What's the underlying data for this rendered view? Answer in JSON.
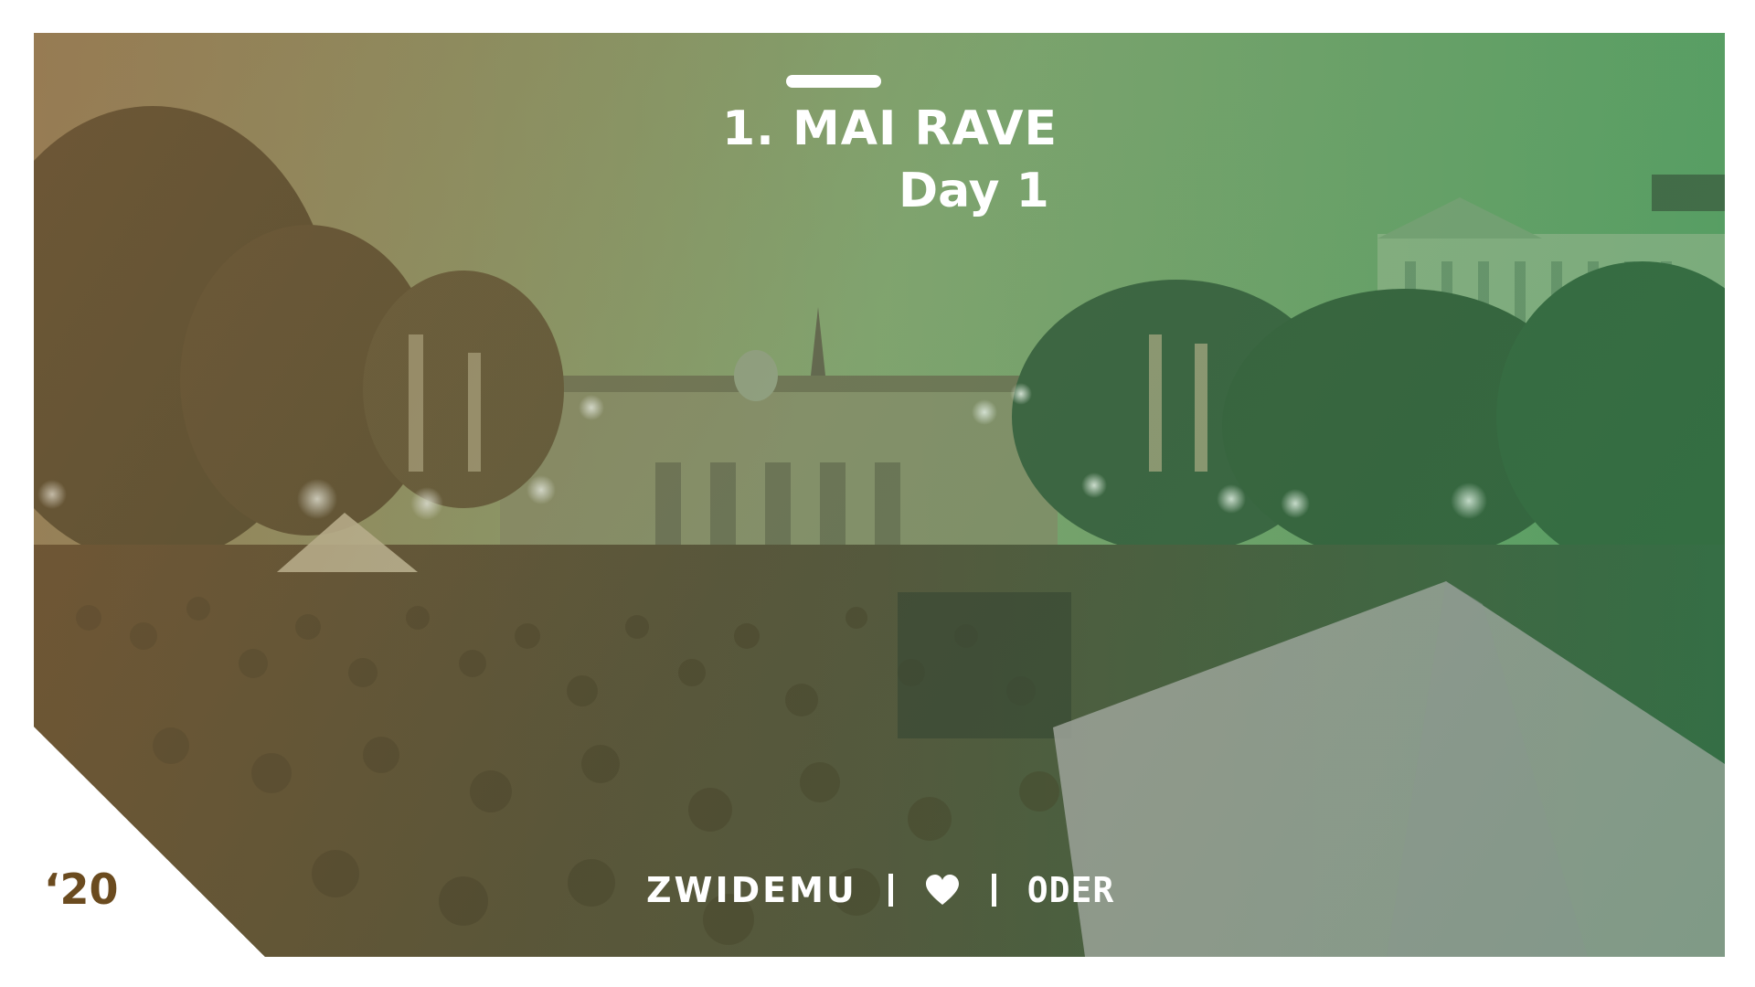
{
  "header": {
    "title": "1. MAI RAVE",
    "subtitle": "Day 1"
  },
  "footer": {
    "brand": "ZWIDEMU",
    "separator": "|",
    "heart_icon": "heart-icon",
    "partner": "ODER"
  },
  "year": "‘20",
  "colors": {
    "overlay_warm": "#8c6e46",
    "overlay_green": "#3c965a",
    "text": "#ffffff",
    "year_text": "#6b4b1f"
  }
}
